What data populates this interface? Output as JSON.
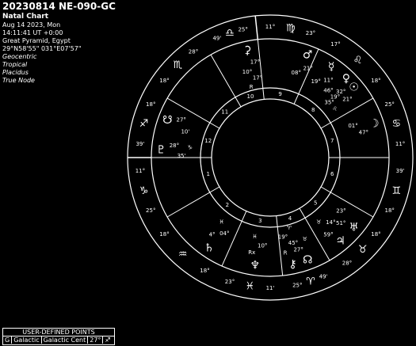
{
  "header": {
    "title": "20230814 NE-090-GC",
    "subtitle": "Natal Chart",
    "date": "Aug 14 2023, Mon",
    "time": "14:11:41 UT +0:00",
    "place": "Great Pyramid, Egypt",
    "coords": "29°N58'55\" 031°E07'57\"",
    "options": [
      "Geocentric",
      "Tropical",
      "Placidus",
      "True Node"
    ]
  },
  "house_numbers": [
    "1",
    "2",
    "3",
    "4",
    "5",
    "6",
    "7",
    "8",
    "9",
    "10",
    "11",
    "12"
  ],
  "cusp_degrees": [
    {
      "deg": "11°",
      "min": "39'"
    },
    {
      "deg": "18°",
      "min": "25°"
    },
    {
      "deg": "23°",
      "min": "18°"
    },
    {
      "deg": "25°",
      "min": "11'"
    },
    {
      "deg": "28°",
      "min": "49'"
    },
    {
      "deg": "18°",
      "min": "18°"
    },
    {
      "deg": "11°",
      "min": "39'"
    },
    {
      "deg": "18°",
      "min": "25°"
    },
    {
      "deg": "23°",
      "min": "17°"
    },
    {
      "deg": "25°",
      "min": "11°"
    },
    {
      "deg": "28°",
      "min": "49'"
    },
    {
      "deg": "18°",
      "min": "18°"
    }
  ],
  "signs": [
    {
      "name": "capricorn",
      "glyph": "♑"
    },
    {
      "name": "aquarius",
      "glyph": "♒"
    },
    {
      "name": "pisces",
      "glyph": "♓"
    },
    {
      "name": "aries",
      "glyph": "♈"
    },
    {
      "name": "taurus",
      "glyph": "♉"
    },
    {
      "name": "gemini",
      "glyph": "♊"
    },
    {
      "name": "cancer",
      "glyph": "♋"
    },
    {
      "name": "leo",
      "glyph": "♌"
    },
    {
      "name": "virgo",
      "glyph": "♍"
    },
    {
      "name": "libra",
      "glyph": "♎"
    },
    {
      "name": "scorpio",
      "glyph": "♏"
    },
    {
      "name": "sagittarius",
      "glyph": "♐"
    }
  ],
  "planets": [
    {
      "name": "pluto",
      "glyph": "♇",
      "labels": [
        "28°",
        "35'",
        "♑"
      ]
    },
    {
      "name": "south-node",
      "glyph": "☋",
      "labels": [
        "27°",
        "10'"
      ]
    },
    {
      "name": "saturn",
      "glyph": "♄",
      "labels": [
        "4°",
        "04°",
        "♓"
      ]
    },
    {
      "name": "neptune",
      "glyph": "♆",
      "labels": [
        "Rx",
        "10°",
        "♓"
      ]
    },
    {
      "name": "chiron",
      "glyph": "⚷",
      "labels": [
        "R",
        "45°",
        "19°",
        "♈"
      ]
    },
    {
      "name": "north-node",
      "glyph": "☊",
      "labels": [
        "27°",
        "♉"
      ]
    },
    {
      "name": "jupiter",
      "glyph": "♃",
      "labels": [
        "59°",
        "14°",
        "♉"
      ]
    },
    {
      "name": "uranus",
      "glyph": "♅",
      "labels": [
        "51°",
        "23°"
      ]
    },
    {
      "name": "moon",
      "glyph": "☽",
      "labels": [
        "47°",
        "01°"
      ]
    },
    {
      "name": "sun",
      "glyph": "☉",
      "labels": [
        "21°",
        "19°",
        "♌"
      ]
    },
    {
      "name": "venus",
      "glyph": "♀",
      "labels": [
        "32°",
        "46°",
        "35°"
      ]
    },
    {
      "name": "mercury",
      "glyph": "☿",
      "labels": [
        "11°",
        "19°"
      ]
    },
    {
      "name": "mars",
      "glyph": "♂",
      "labels": [
        "21°",
        "08°"
      ]
    },
    {
      "name": "ceres",
      "glyph": "⚳",
      "labels": [
        "17°",
        "10°",
        "17°",
        "R"
      ]
    }
  ],
  "user_defined": {
    "heading": "USER-DEFINED POINTS",
    "row": [
      "G",
      "Galactic",
      "Galactic Cent",
      "27°",
      "♐"
    ]
  }
}
